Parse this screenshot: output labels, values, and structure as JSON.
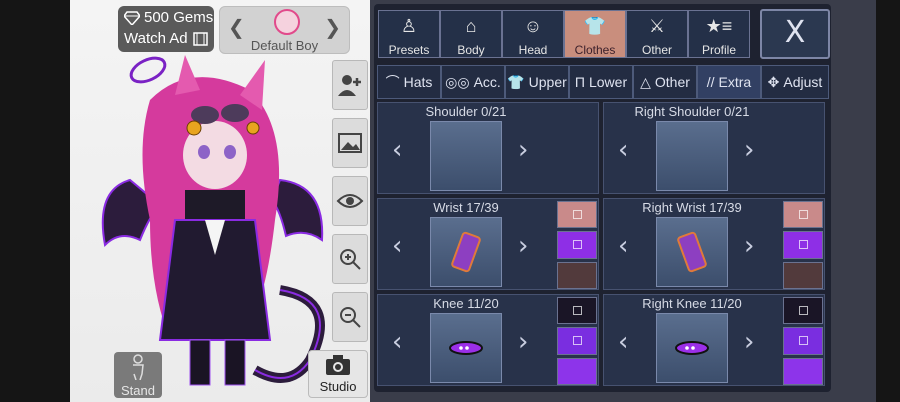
{
  "header": {
    "gems": "500 Gems",
    "watch_ad": "Watch Ad",
    "character_name": "Default Boy"
  },
  "stage_buttons": {
    "stand": "Stand",
    "studio": "Studio"
  },
  "categories": [
    {
      "label": "Presets",
      "icon": "person-silhouette-icon"
    },
    {
      "label": "Body",
      "icon": "jacket-icon"
    },
    {
      "label": "Head",
      "icon": "hair-icon"
    },
    {
      "label": "Clothes",
      "icon": "shirt-icon"
    },
    {
      "label": "Other",
      "icon": "sword-cat-icon"
    },
    {
      "label": "Profile",
      "icon": "star-list-icon"
    }
  ],
  "active_category": "Clothes",
  "close_label": "X",
  "subtabs": [
    {
      "label": "Hats",
      "icon": "cap-icon"
    },
    {
      "label": "Acc.",
      "icon": "glasses-icon"
    },
    {
      "label": "Upper",
      "icon": "shirt-icon"
    },
    {
      "label": "Lower",
      "icon": "pants-icon"
    },
    {
      "label": "Other",
      "icon": "cape-icon"
    },
    {
      "label": "Extra",
      "icon": "slash-icon"
    },
    {
      "label": "Adjust",
      "icon": "move-icon"
    }
  ],
  "active_subtab": "Extra",
  "slots": [
    {
      "title": "Shoulder 0/21",
      "colors": []
    },
    {
      "title": "Right Shoulder 0/21",
      "colors": []
    },
    {
      "title": "Wrist 17/39",
      "colors": [
        "#c98a8a",
        "#8e2fe6",
        "#523a3c"
      ]
    },
    {
      "title": "Right Wrist 17/39",
      "colors": [
        "#c98a8a",
        "#8e2fe6",
        "#523a3c"
      ]
    },
    {
      "title": "Knee 11/20",
      "colors": [
        "#1a1526",
        "#7a2ee0",
        "#8d34ea"
      ]
    },
    {
      "title": "Right Knee 11/20",
      "colors": [
        "#1a1526",
        "#7a2ee0",
        "#8d34ea"
      ]
    }
  ],
  "colors": {
    "panel_bg": "#1e2230",
    "active_tab": "#c98e7d",
    "accent_purple": "#8e2fe6"
  }
}
